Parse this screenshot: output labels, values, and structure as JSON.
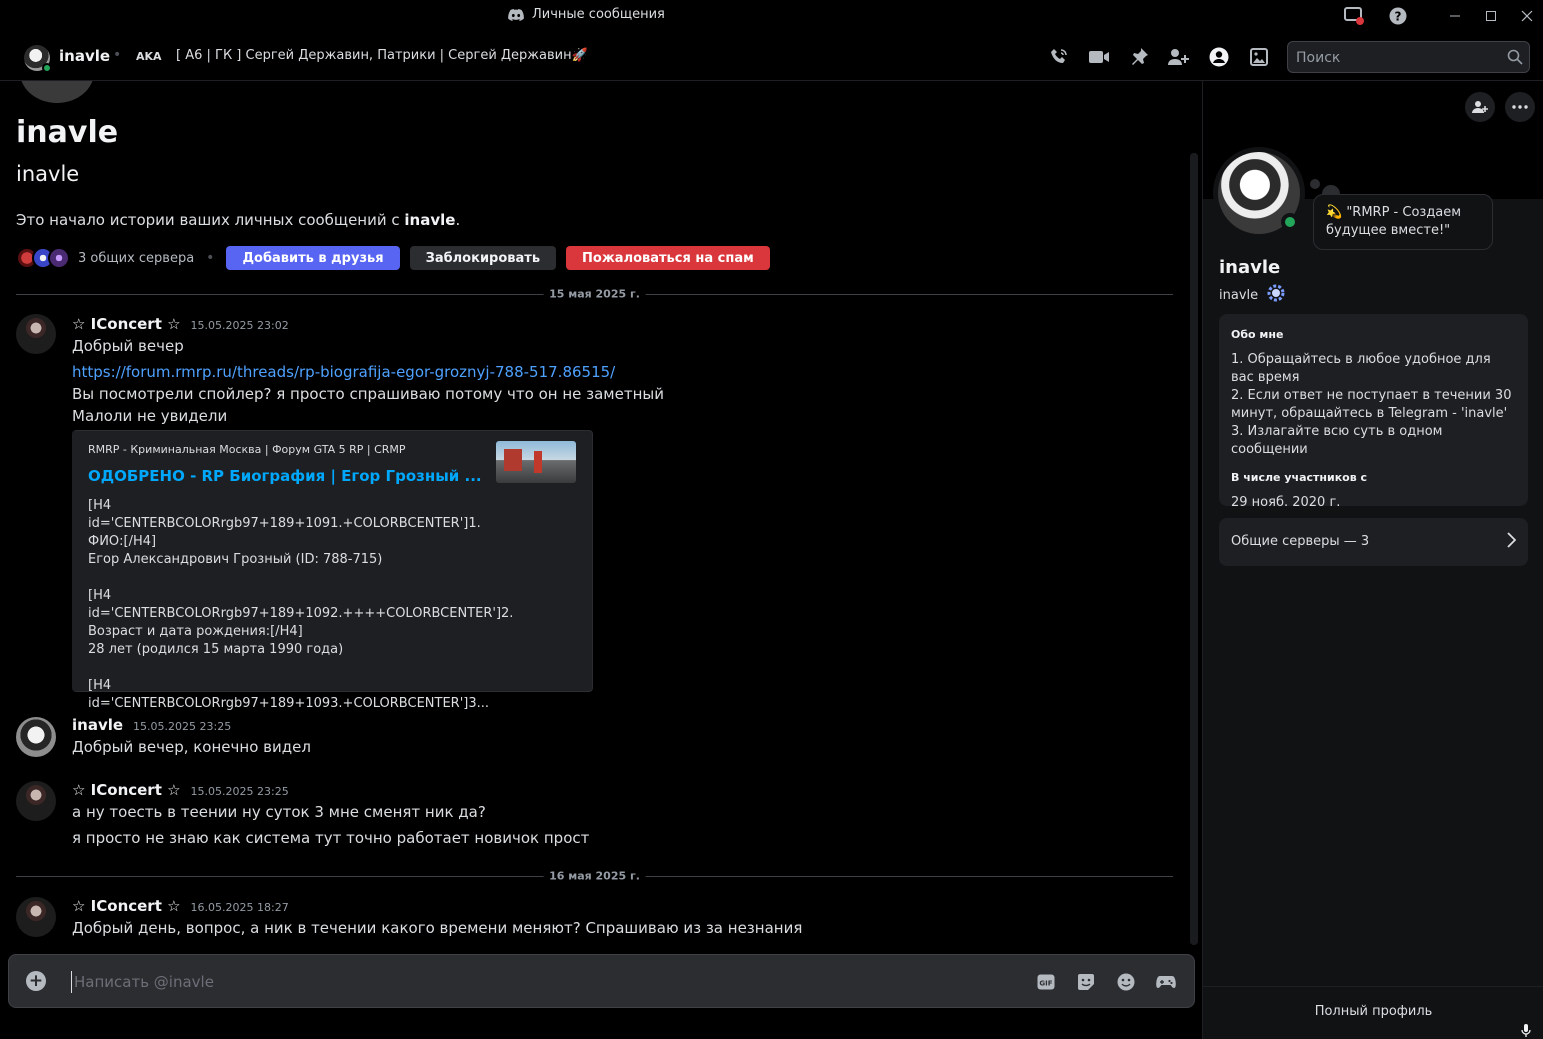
{
  "window": {
    "title": "Личные сообщения"
  },
  "header": {
    "username": "inavle",
    "aka_label": "AKA",
    "aka_names": "[ А6 | ГК ] Сергей Державин, Патрики | Сергей Державин🚀",
    "search_placeholder": "Поиск"
  },
  "intro": {
    "title": "inavle",
    "subtitle": "inavle",
    "text_prefix": "Это начало истории ваших личных сообщений с ",
    "text_name": "inavle",
    "text_suffix": ".",
    "mutual_servers": "3 общих сервера",
    "btn_add_friend": "Добавить в друзья",
    "btn_block": "Заблокировать",
    "btn_report": "Пожаловаться на спам"
  },
  "dividers": {
    "first": "15 мая 2025 г.",
    "second": "16 мая 2025 г."
  },
  "messages": [
    {
      "author": "☆ IConcert ☆",
      "time": "15.05.2025 23:02",
      "lines": [
        "Добрый вечер",
        "https://forum.rmrp.ru/threads/rp-biografija-egor-groznyj-788-517.86515/",
        "Вы посмотрели спойлер? я просто спрашиваю потому что он не заметный",
        "Малоли не увидели"
      ]
    },
    {
      "author": "inavle",
      "time": "15.05.2025 23:25",
      "lines": [
        "Добрый вечер, конечно видел"
      ]
    },
    {
      "author": "☆ IConcert ☆",
      "time": "15.05.2025 23:25",
      "lines": [
        "а ну тоесть в теении ну суток 3 мне сменят ник да?",
        "я просто не знаю как система тут точно работает новичок прост"
      ]
    },
    {
      "author": "☆ IConcert ☆",
      "time": "16.05.2025 18:27",
      "lines": [
        "Добрый день, вопрос, а ник в течении какого времени меняют? Спрашиваю из за незнания"
      ]
    }
  ],
  "embed": {
    "provider": "RMRP - Криминальная Москва | Форум GTA 5 RP  | CRMP",
    "title": "ОДОБРЕНО - RP Биография | Егор Грозный ...",
    "description": "[H4 id='CENTERBCOLORrgb97+189+1091.+COLORBCENTER']1.\nФИО:[/H4]\nЕгор Александрович Грозный (ID: 788-715)\n\n[H4\nid='CENTERBCOLORrgb97+189+1092.++++COLORBCENTER']2.\nВозраст и дата рождения:[/H4]\n28 лет (родился 15 марта 1990 года)\n\n[H4 id='CENTERBCOLORrgb97+189+1093.+COLORBCENTER']3..."
  },
  "composer": {
    "placeholder": "Написать @inavle"
  },
  "profile": {
    "status": "💫 \"RMRP - Создаем будущее вместе!\"",
    "name": "inavle",
    "handle": "inavle",
    "about_heading": "Обо мне",
    "about_lines": [
      "1. Обращайтесь в любое удобное для вас время",
      "2. Если ответ не поступает в течении 30 минут, обращайтесь в Telegram - 'inavle'",
      "3. Излагайте всю суть в одном сообщении"
    ],
    "member_heading": "В числе участников с",
    "member_since": "29 нояб. 2020 г.",
    "mutual_servers": "Общие серверы — 3",
    "full_profile": "Полный профиль"
  },
  "colors": {
    "brand": "#5865f2",
    "danger": "#da373c",
    "online": "#23a55a",
    "link": "#4ea1ff"
  }
}
